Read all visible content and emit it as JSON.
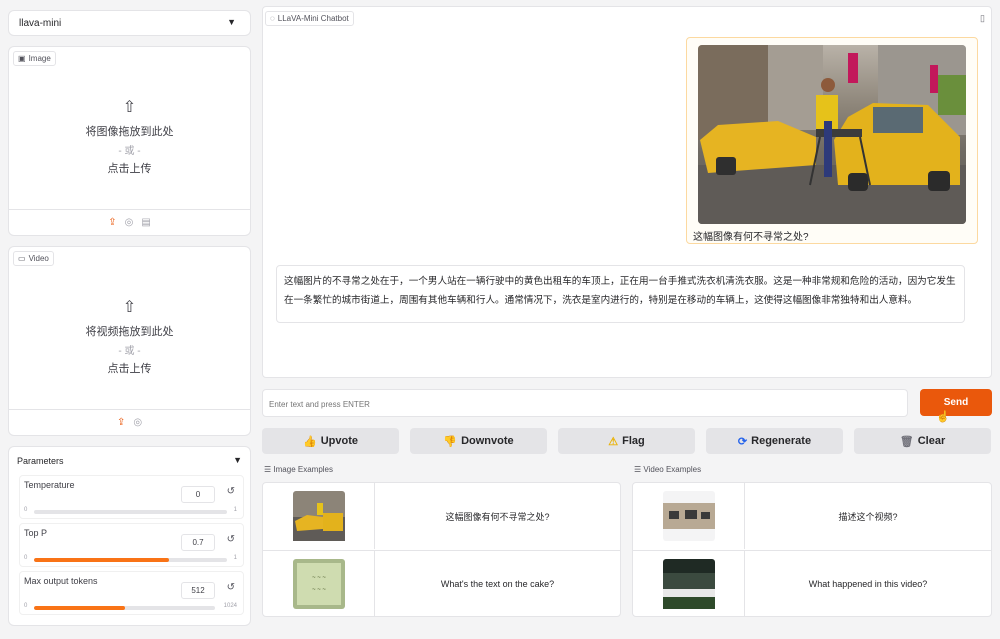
{
  "model_select": {
    "value": "llava-mini"
  },
  "image_panel": {
    "tag": "Image",
    "drop_text": "将图像拖放到此处",
    "or_text": "- 或 -",
    "click_text": "点击上传"
  },
  "video_panel": {
    "tag": "Video",
    "drop_text": "将视频拖放到此处",
    "or_text": "- 或 -",
    "click_text": "点击上传"
  },
  "parameters": {
    "title": "Parameters",
    "temperature": {
      "label": "Temperature",
      "value": "0",
      "min": "0",
      "max": "1",
      "fraction": 0.0
    },
    "top_p": {
      "label": "Top P",
      "value": "0.7",
      "min": "0",
      "max": "1",
      "fraction": 0.7
    },
    "max_tokens": {
      "label": "Max output tokens",
      "value": "512",
      "min": "0",
      "max": "1024",
      "fraction": 0.5
    }
  },
  "chatbot": {
    "tag": "LLaVA-Mini Chatbot",
    "user_message": "这幅图像有何不寻常之处?",
    "bot_message": "这幅图片的不寻常之处在于，一个男人站在一辆行驶中的黄色出租车的车顶上，正在用一台手推式洗衣机清洗衣服。这是一种非常规和危险的活动，因为它发生在一条繁忙的城市街道上，周围有其他车辆和行人。通常情况下，洗衣是室内进行的，特别是在移动的车辆上，这使得这幅图像非常独特和出人意料。"
  },
  "input": {
    "placeholder": "Enter text and press ENTER",
    "send_label": "Send"
  },
  "actions": {
    "upvote": "Upvote",
    "downvote": "Downvote",
    "flag": "Flag",
    "regenerate": "Regenerate",
    "clear": "Clear"
  },
  "image_examples": {
    "title": "Image Examples",
    "rows": [
      "这幅图像有何不寻常之处?",
      "What's the text on the cake?"
    ]
  },
  "video_examples": {
    "title": "Video Examples",
    "rows": [
      "描述这个视频?",
      "What happened in this video?"
    ]
  },
  "colors": {
    "accent": "#ea580c",
    "send_bg": "#ea580c",
    "user_bubble_border": "#fcd9a0"
  }
}
